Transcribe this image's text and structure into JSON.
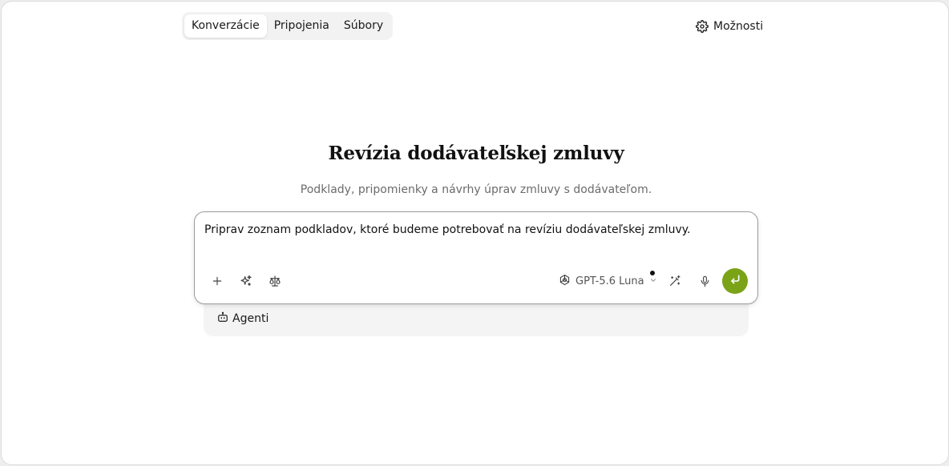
{
  "header": {
    "tabs": [
      {
        "label": "Konverzácie",
        "active": true
      },
      {
        "label": "Pripojenia",
        "active": false
      },
      {
        "label": "Súbory",
        "active": false
      }
    ],
    "options_label": "Možnosti",
    "options_icon": "gear-icon"
  },
  "main": {
    "title": "Revízia dodávateľskej zmluvy",
    "subtitle": "Podklady, pripomienky a návrhy úprav zmluvy s dodávateľom."
  },
  "composer": {
    "prompt_text": "Priprav zoznam podkladov, ktoré budeme potrebovať na revíziu dodávateľskej zmluvy.",
    "left_icons": [
      "plus-icon",
      "sparkle-icon",
      "scale-icon"
    ],
    "model_label": "GPT-5.6 Luna",
    "model_icon": "openai-icon",
    "right_icons": [
      "magic-wand-icon",
      "microphone-icon"
    ],
    "send_icon": "enter-arrow-icon",
    "send_color": "#7aa317"
  },
  "agents": {
    "label": "Agenti",
    "icon": "robot-icon"
  }
}
